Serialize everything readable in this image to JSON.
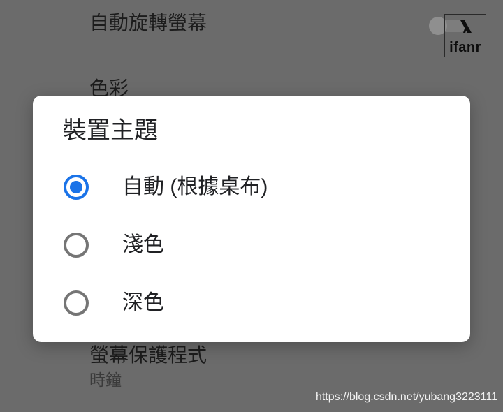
{
  "background": {
    "settings": [
      {
        "title": "自動旋轉螢幕"
      },
      {
        "title": "色彩"
      },
      {
        "title": "螢幕保護程式",
        "summary": "時鐘"
      }
    ],
    "auto_rotate_toggle": {
      "checked": false
    }
  },
  "dialog": {
    "title": "裝置主題",
    "options": [
      {
        "label": "自動 (根據桌布)",
        "selected": true
      },
      {
        "label": "淺色",
        "selected": false
      },
      {
        "label": "深色",
        "selected": false
      }
    ]
  },
  "watermarks": {
    "logo_text": "ifanr",
    "url": "https://blog.csdn.net/yubang3223111"
  },
  "colors": {
    "accent": "#1a73e8",
    "scrim": "#6b6b6b",
    "dialog": "#ffffff",
    "radio_unselected": "#757575"
  }
}
